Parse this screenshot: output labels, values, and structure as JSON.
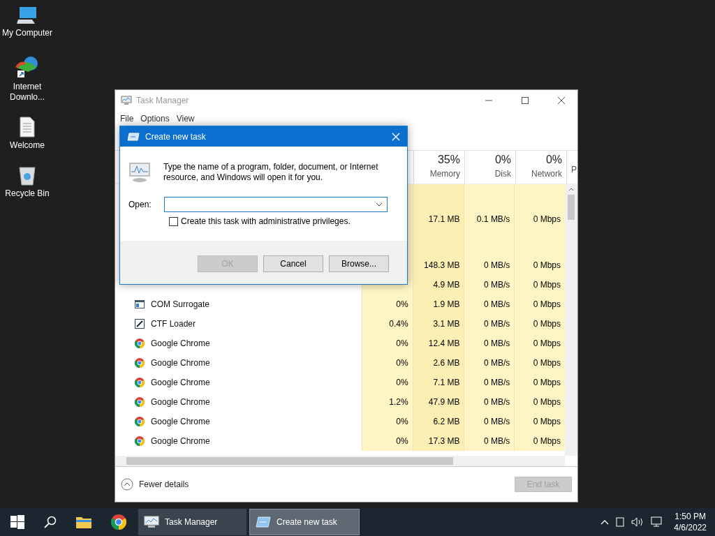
{
  "desktop_icons": [
    {
      "label": "My Computer",
      "kind": "computer"
    },
    {
      "label": "Internet Downlo...",
      "kind": "downloader"
    },
    {
      "label": "Welcome",
      "kind": "document"
    },
    {
      "label": "Recycle Bin",
      "kind": "recycle"
    }
  ],
  "task_manager": {
    "title": "Task Manager",
    "menu": [
      "File",
      "Options",
      "View"
    ],
    "columns": [
      {
        "value": "35%",
        "label": "Memory"
      },
      {
        "value": "0%",
        "label": "Disk"
      },
      {
        "value": "0%",
        "label": "Network"
      },
      {
        "label": "P"
      }
    ],
    "rows": [
      {
        "kind": "group"
      },
      {
        "kind": "process",
        "memory": "17.1 MB",
        "disk": "0.1 MB/s",
        "network": "0 Mbps"
      },
      {
        "kind": "group"
      },
      {
        "kind": "process",
        "memory": "148.3 MB",
        "disk": "0 MB/s",
        "network": "0 Mbps"
      },
      {
        "kind": "process",
        "memory": "4.9 MB",
        "disk": "0 MB/s",
        "network": "0 Mbps"
      },
      {
        "kind": "window",
        "name": "COM Surrogate",
        "cpu": "0%",
        "memory": "1.9 MB",
        "disk": "0 MB/s",
        "network": "0 Mbps"
      },
      {
        "kind": "pen",
        "name": "CTF Loader",
        "cpu": "0.4%",
        "memory": "3.1 MB",
        "disk": "0 MB/s",
        "network": "0 Mbps"
      },
      {
        "kind": "chrome",
        "name": "Google Chrome",
        "cpu": "0%",
        "memory": "12.4 MB",
        "disk": "0 MB/s",
        "network": "0 Mbps"
      },
      {
        "kind": "chrome",
        "name": "Google Chrome",
        "cpu": "0%",
        "memory": "2.6 MB",
        "disk": "0 MB/s",
        "network": "0 Mbps"
      },
      {
        "kind": "chrome",
        "name": "Google Chrome",
        "cpu": "0%",
        "memory": "7.1 MB",
        "disk": "0 MB/s",
        "network": "0 Mbps"
      },
      {
        "kind": "chrome",
        "name": "Google Chrome",
        "cpu": "1.2%",
        "memory": "47.9 MB",
        "disk": "0 MB/s",
        "network": "0 Mbps"
      },
      {
        "kind": "chrome",
        "name": "Google Chrome",
        "cpu": "0%",
        "memory": "6.2 MB",
        "disk": "0 MB/s",
        "network": "0 Mbps"
      },
      {
        "kind": "chrome",
        "name": "Google Chrome",
        "cpu": "0%",
        "memory": "17.3 MB",
        "disk": "0 MB/s",
        "network": "0 Mbps"
      }
    ],
    "fewer_details": "Fewer details",
    "end_task": {
      "label": "End task",
      "disabled": true
    }
  },
  "dialog": {
    "title": "Create new task",
    "message": "Type the name of a program, folder, document, or Internet resource, and Windows will open it for you.",
    "open_label": "Open:",
    "admin_checkbox": {
      "label": "Create this task with administrative privileges.",
      "checked": false
    },
    "buttons": [
      {
        "label": "OK",
        "disabled": true
      },
      {
        "label": "Cancel",
        "disabled": false
      },
      {
        "label": "Browse...",
        "disabled": false
      }
    ]
  },
  "taskbar": {
    "windows": [
      {
        "label": "Task Manager",
        "kind": "taskmgr",
        "selected": false
      },
      {
        "label": "Create new task",
        "kind": "run",
        "selected": true
      }
    ],
    "time": "1:50 PM",
    "date": "4/6/2022"
  }
}
